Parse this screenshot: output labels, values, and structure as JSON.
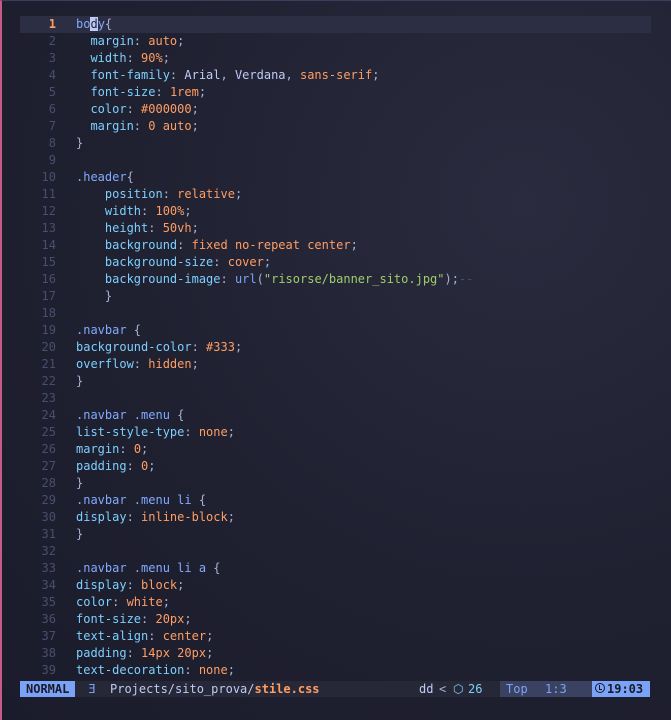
{
  "editor": {
    "current_line": 1,
    "lines": [
      {
        "n": "1",
        "t": [
          [
            "body",
            "t-sel-cursor"
          ],
          [
            "{",
            "t-punc"
          ]
        ]
      },
      {
        "n": "2",
        "t": [
          [
            "  margin",
            "t-prop"
          ],
          [
            ": ",
            "t-punc"
          ],
          [
            "auto",
            "t-val"
          ],
          [
            ";",
            "t-punc"
          ]
        ]
      },
      {
        "n": "3",
        "t": [
          [
            "  width",
            "t-prop"
          ],
          [
            ": ",
            "t-punc"
          ],
          [
            "90%",
            "t-num"
          ],
          [
            ";",
            "t-punc"
          ]
        ]
      },
      {
        "n": "4",
        "t": [
          [
            "  font-family",
            "t-prop"
          ],
          [
            ": ",
            "t-punc"
          ],
          [
            "Arial",
            "t-plain"
          ],
          [
            ", ",
            "t-punc"
          ],
          [
            "Verdana",
            "t-plain"
          ],
          [
            ", ",
            "t-punc"
          ],
          [
            "sans-serif",
            "t-val"
          ],
          [
            ";",
            "t-punc"
          ]
        ]
      },
      {
        "n": "5",
        "t": [
          [
            "  font-size",
            "t-prop"
          ],
          [
            ": ",
            "t-punc"
          ],
          [
            "1rem",
            "t-num"
          ],
          [
            ";",
            "t-punc"
          ]
        ]
      },
      {
        "n": "6",
        "t": [
          [
            "  color",
            "t-prop"
          ],
          [
            ": ",
            "t-punc"
          ],
          [
            "#000000",
            "t-num"
          ],
          [
            ";",
            "t-punc"
          ]
        ]
      },
      {
        "n": "7",
        "t": [
          [
            "  margin",
            "t-prop"
          ],
          [
            ": ",
            "t-punc"
          ],
          [
            "0 auto",
            "t-val"
          ],
          [
            ";",
            "t-punc"
          ]
        ]
      },
      {
        "n": "8",
        "t": [
          [
            "}",
            "t-punc"
          ]
        ]
      },
      {
        "n": "9",
        "t": []
      },
      {
        "n": "10",
        "t": [
          [
            ".header",
            "t-sel"
          ],
          [
            "{",
            "t-punc"
          ]
        ]
      },
      {
        "n": "11",
        "t": [
          [
            "    position",
            "t-prop"
          ],
          [
            ": ",
            "t-punc"
          ],
          [
            "relative",
            "t-val"
          ],
          [
            ";",
            "t-punc"
          ]
        ]
      },
      {
        "n": "12",
        "t": [
          [
            "    width",
            "t-prop"
          ],
          [
            ": ",
            "t-punc"
          ],
          [
            "100%",
            "t-num"
          ],
          [
            ";",
            "t-punc"
          ]
        ]
      },
      {
        "n": "13",
        "t": [
          [
            "    height",
            "t-prop"
          ],
          [
            ": ",
            "t-punc"
          ],
          [
            "50vh",
            "t-num"
          ],
          [
            ";",
            "t-punc"
          ]
        ]
      },
      {
        "n": "14",
        "t": [
          [
            "    background",
            "t-prop"
          ],
          [
            ": ",
            "t-punc"
          ],
          [
            "fixed no-repeat center",
            "t-val"
          ],
          [
            ";",
            "t-punc"
          ]
        ]
      },
      {
        "n": "15",
        "t": [
          [
            "    background-size",
            "t-prop"
          ],
          [
            ": ",
            "t-punc"
          ],
          [
            "cover",
            "t-val"
          ],
          [
            ";",
            "t-punc"
          ]
        ]
      },
      {
        "n": "16",
        "t": [
          [
            "    background-image",
            "t-prop"
          ],
          [
            ": ",
            "t-punc"
          ],
          [
            "url",
            "t-func"
          ],
          [
            "(",
            "t-punc"
          ],
          [
            "\"risorse/banner_sito.jpg\"",
            "t-str"
          ],
          [
            ");",
            "t-punc"
          ],
          [
            "--",
            "t-ghost"
          ]
        ]
      },
      {
        "n": "17",
        "t": [
          [
            "    }",
            "t-punc"
          ]
        ]
      },
      {
        "n": "18",
        "t": []
      },
      {
        "n": "19",
        "t": [
          [
            ".navbar ",
            "t-sel"
          ],
          [
            "{",
            "t-punc"
          ]
        ]
      },
      {
        "n": "20",
        "t": [
          [
            "background-color",
            "t-prop"
          ],
          [
            ": ",
            "t-punc"
          ],
          [
            "#333",
            "t-num"
          ],
          [
            ";",
            "t-punc"
          ]
        ]
      },
      {
        "n": "21",
        "t": [
          [
            "overflow",
            "t-prop"
          ],
          [
            ": ",
            "t-punc"
          ],
          [
            "hidden",
            "t-val"
          ],
          [
            ";",
            "t-punc"
          ]
        ]
      },
      {
        "n": "22",
        "t": [
          [
            "}",
            "t-punc"
          ]
        ]
      },
      {
        "n": "23",
        "t": []
      },
      {
        "n": "24",
        "t": [
          [
            ".navbar .menu ",
            "t-sel"
          ],
          [
            "{",
            "t-punc"
          ]
        ]
      },
      {
        "n": "25",
        "t": [
          [
            "list-style-type",
            "t-prop"
          ],
          [
            ": ",
            "t-punc"
          ],
          [
            "none",
            "t-val"
          ],
          [
            ";",
            "t-punc"
          ]
        ]
      },
      {
        "n": "26",
        "t": [
          [
            "margin",
            "t-prop"
          ],
          [
            ": ",
            "t-punc"
          ],
          [
            "0",
            "t-num"
          ],
          [
            ";",
            "t-punc"
          ]
        ]
      },
      {
        "n": "27",
        "t": [
          [
            "padding",
            "t-prop"
          ],
          [
            ": ",
            "t-punc"
          ],
          [
            "0",
            "t-num"
          ],
          [
            ";",
            "t-punc"
          ]
        ]
      },
      {
        "n": "28",
        "t": [
          [
            "}",
            "t-punc"
          ]
        ]
      },
      {
        "n": "29",
        "t": [
          [
            ".navbar .menu li ",
            "t-sel"
          ],
          [
            "{",
            "t-punc"
          ]
        ]
      },
      {
        "n": "30",
        "t": [
          [
            "display",
            "t-prop"
          ],
          [
            ": ",
            "t-punc"
          ],
          [
            "inline-block",
            "t-val"
          ],
          [
            ";",
            "t-punc"
          ]
        ]
      },
      {
        "n": "31",
        "t": [
          [
            "}",
            "t-punc"
          ]
        ]
      },
      {
        "n": "32",
        "t": []
      },
      {
        "n": "33",
        "t": [
          [
            ".navbar .menu li a ",
            "t-sel"
          ],
          [
            "{",
            "t-punc"
          ]
        ]
      },
      {
        "n": "34",
        "t": [
          [
            "display",
            "t-prop"
          ],
          [
            ": ",
            "t-punc"
          ],
          [
            "block",
            "t-val"
          ],
          [
            ";",
            "t-punc"
          ]
        ]
      },
      {
        "n": "35",
        "t": [
          [
            "color",
            "t-prop"
          ],
          [
            ": ",
            "t-punc"
          ],
          [
            "white",
            "t-val"
          ],
          [
            ";",
            "t-punc"
          ]
        ]
      },
      {
        "n": "36",
        "t": [
          [
            "font-size",
            "t-prop"
          ],
          [
            ": ",
            "t-punc"
          ],
          [
            "20px",
            "t-num"
          ],
          [
            ";",
            "t-punc"
          ]
        ]
      },
      {
        "n": "37",
        "t": [
          [
            "text-align",
            "t-prop"
          ],
          [
            ": ",
            "t-punc"
          ],
          [
            "center",
            "t-val"
          ],
          [
            ";",
            "t-punc"
          ]
        ]
      },
      {
        "n": "38",
        "t": [
          [
            "padding",
            "t-prop"
          ],
          [
            ": ",
            "t-punc"
          ],
          [
            "14px 20px",
            "t-num"
          ],
          [
            ";",
            "t-punc"
          ]
        ]
      },
      {
        "n": "39",
        "t": [
          [
            "text-decoration",
            "t-prop"
          ],
          [
            ": ",
            "t-punc"
          ],
          [
            "none",
            "t-val"
          ],
          [
            ";",
            "t-punc"
          ]
        ]
      }
    ]
  },
  "statusline": {
    "mode": "NORMAL",
    "file_icon": "css-file-icon",
    "path_prefix": "Projects/sito_prova/",
    "filename": "stile.css",
    "branch": "dd",
    "chevron": "<",
    "lsp_icon": "package-icon",
    "lsp_icon_glyph": "⬡",
    "lsp_count": "26",
    "scroll_position": "Top",
    "cursor_position": "1:3",
    "clock_icon": "clock-icon",
    "time": "19:03"
  },
  "colors": {
    "mode_bg": "#7aa2f7",
    "filename": "#ff9e64",
    "left_border": "#c85a8a"
  }
}
